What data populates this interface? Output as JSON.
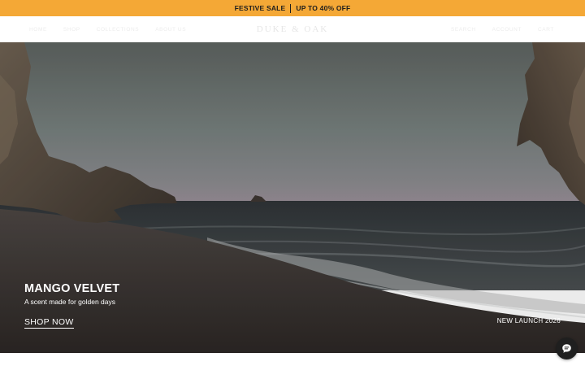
{
  "promo": {
    "left_text": "FESTIVE SALE",
    "right_text": "UP TO 40% OFF",
    "bg_color": "#f4a836"
  },
  "nav": {
    "left_items": [
      "HOME",
      "SHOP",
      "COLLECTIONS",
      "ABOUT US"
    ],
    "brand": "DUKE & OAK",
    "right_items": [
      "SEARCH",
      "ACCOUNT",
      "CART"
    ]
  },
  "hero": {
    "title": "MANGO VELVET",
    "subtitle": "A scent made for golden days",
    "cta_label": "SHOP NOW",
    "launch_label": "NEW LAUNCH 2026"
  },
  "chat": {
    "icon": "chat-bubble-icon"
  }
}
